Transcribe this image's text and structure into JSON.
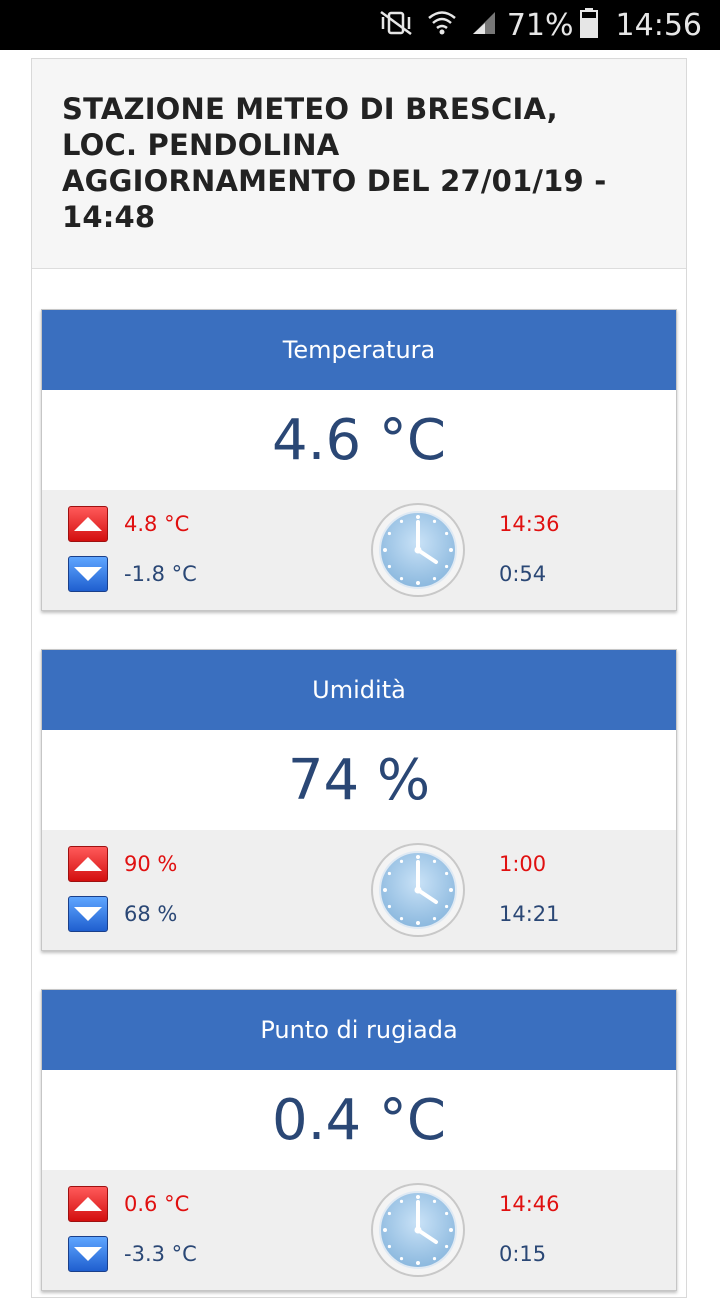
{
  "status_bar": {
    "battery_percent": "71%",
    "time": "14:56",
    "icons": [
      "vibrate-icon",
      "wifi-icon",
      "signal-icon",
      "battery-icon"
    ]
  },
  "header": {
    "title_line1": "STAZIONE METEO DI BRESCIA,",
    "title_line2": "LOC. PENDOLINA",
    "title_line3": "AGGIORNAMENTO DEL 27/01/19 -",
    "title_line4": "14:48"
  },
  "panels": [
    {
      "title": "Temperatura",
      "value": "4.6 °C",
      "max_value": "4.8 °C",
      "min_value": "-1.8 °C",
      "max_time": "14:36",
      "min_time": "0:54"
    },
    {
      "title": "Umidità",
      "value": "74 %",
      "max_value": "90 %",
      "min_value": "68 %",
      "max_time": "1:00",
      "min_time": "14:21"
    },
    {
      "title": "Punto di rugiada",
      "value": "0.4 °C",
      "max_value": "0.6 °C",
      "min_value": "-3.3 °C",
      "max_time": "14:46",
      "min_time": "0:15"
    }
  ],
  "colors": {
    "panel_header": "#3a6fbf",
    "value_text": "#2a4775",
    "max_red": "#e01010",
    "footer_bg": "#efefef"
  }
}
